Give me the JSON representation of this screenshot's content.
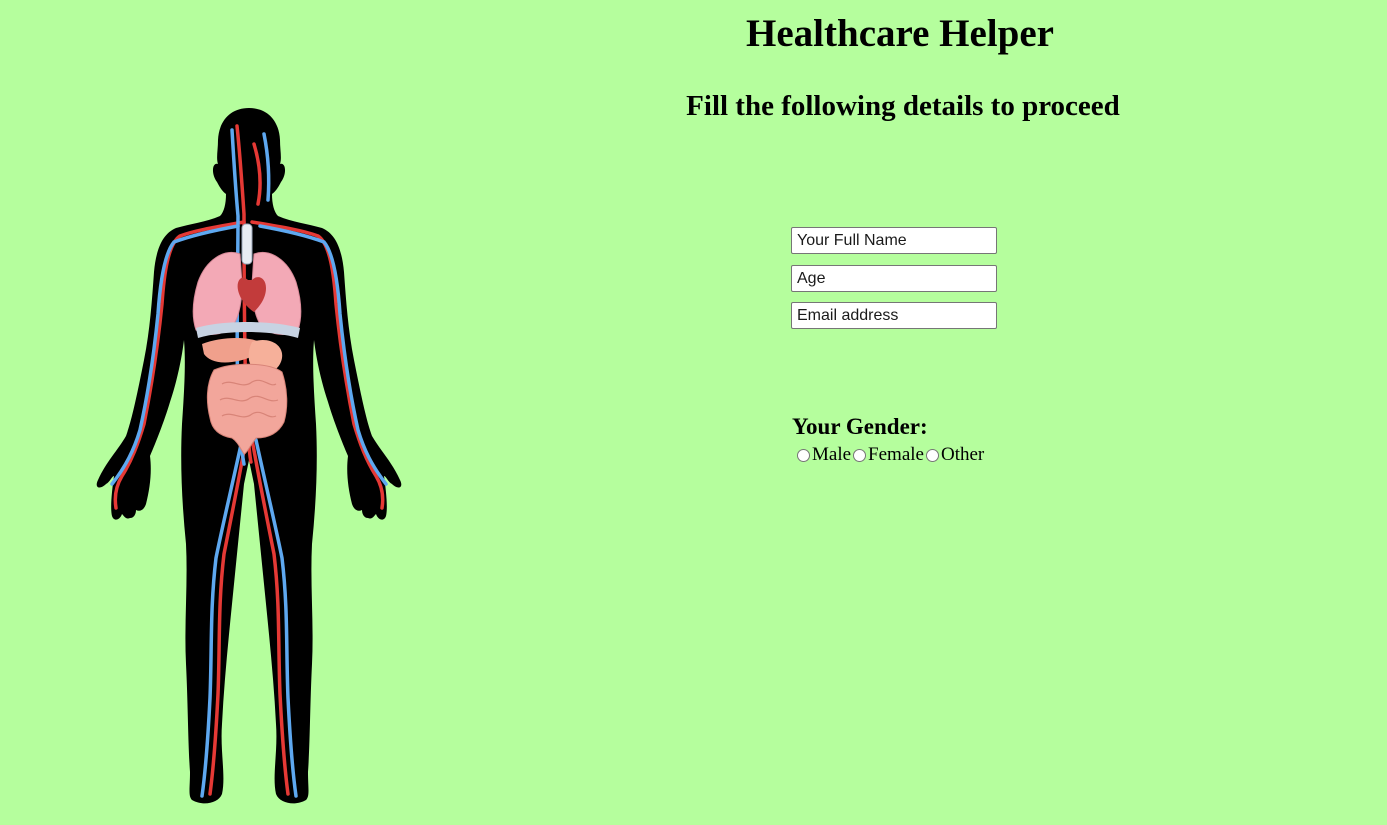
{
  "header": {
    "title": "Healthcare Helper",
    "subtitle": "Fill the following details to proceed"
  },
  "form": {
    "name_placeholder": "Your Full Name",
    "age_placeholder": "Age",
    "email_placeholder": "Email address",
    "gender_label": "Your Gender:",
    "gender_options": [
      "Male",
      "Female",
      "Other"
    ]
  },
  "illustration": {
    "icon": "human-anatomy-illustration",
    "colors": {
      "body": "#000000",
      "arteries": "#e53935",
      "veins": "#5ea8f0",
      "organs": "#f1a7b0"
    }
  },
  "colors": {
    "background": "#b5fe9d"
  }
}
